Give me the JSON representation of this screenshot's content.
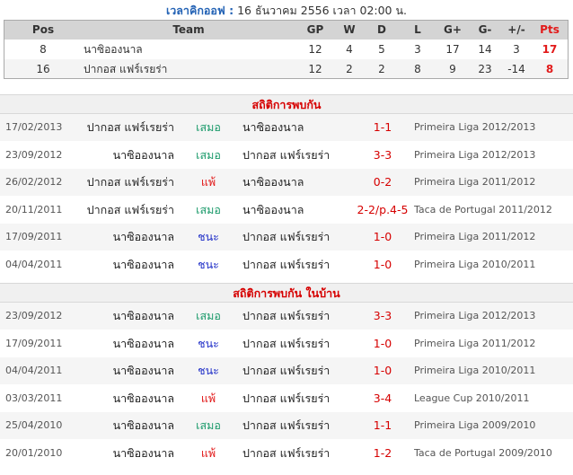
{
  "kickoff": {
    "label": "เวลาคิกออฟ :",
    "value": "16 ธันวาคม 2556 เวลา 02:00 น."
  },
  "standings": {
    "headers": [
      "Pos",
      "Team",
      "GP",
      "W",
      "D",
      "L",
      "G+",
      "G-",
      "+/-",
      "Pts"
    ],
    "rows": [
      {
        "pos": "8",
        "team": "นาซิอองนาล",
        "gp": "12",
        "w": "4",
        "d": "5",
        "l": "3",
        "gf": "17",
        "ga": "14",
        "diff": "3",
        "pts": "17"
      },
      {
        "pos": "16",
        "team": "ปากอส แฟร์เรยร่า",
        "gp": "12",
        "w": "2",
        "d": "2",
        "l": "8",
        "gf": "9",
        "ga": "23",
        "diff": "-14",
        "pts": "8"
      }
    ]
  },
  "h2h": {
    "title": "สถิติการพบกัน",
    "matches": [
      {
        "date": "17/02/2013",
        "home": "ปากอส แฟร์เรยร่า",
        "result": "เสมอ",
        "result_type": "draw",
        "away": "นาซิอองนาล",
        "score": "1-1",
        "competition": "Primeira Liga 2012/2013"
      },
      {
        "date": "23/09/2012",
        "home": "นาซิอองนาล",
        "result": "เสมอ",
        "result_type": "draw",
        "away": "ปากอส แฟร์เรยร่า",
        "score": "3-3",
        "competition": "Primeira Liga 2012/2013"
      },
      {
        "date": "26/02/2012",
        "home": "ปากอส แฟร์เรยร่า",
        "result": "แพ้",
        "result_type": "loss",
        "away": "นาซิอองนาล",
        "score": "0-2",
        "competition": "Primeira Liga 2011/2012"
      },
      {
        "date": "20/11/2011",
        "home": "ปากอส แฟร์เรยร่า",
        "result": "เสมอ",
        "result_type": "draw",
        "away": "นาซิอองนาล",
        "score": "2-2/p.4-5",
        "competition": "Taca de Portugal 2011/2012"
      },
      {
        "date": "17/09/2011",
        "home": "นาซิอองนาล",
        "result": "ชนะ",
        "result_type": "win",
        "away": "ปากอส แฟร์เรยร่า",
        "score": "1-0",
        "competition": "Primeira Liga 2011/2012"
      },
      {
        "date": "04/04/2011",
        "home": "นาซิอองนาล",
        "result": "ชนะ",
        "result_type": "win",
        "away": "ปากอส แฟร์เรยร่า",
        "score": "1-0",
        "competition": "Primeira Liga 2010/2011"
      }
    ]
  },
  "home_h2h": {
    "title": "สถิติการพบกัน ในบ้าน",
    "matches": [
      {
        "date": "23/09/2012",
        "home": "นาซิอองนาล",
        "result": "เสมอ",
        "result_type": "draw",
        "away": "ปากอส แฟร์เรยร่า",
        "score": "3-3",
        "competition": "Primeira Liga 2012/2013"
      },
      {
        "date": "17/09/2011",
        "home": "นาซิอองนาล",
        "result": "ชนะ",
        "result_type": "win",
        "away": "ปากอส แฟร์เรยร่า",
        "score": "1-0",
        "competition": "Primeira Liga 2011/2012"
      },
      {
        "date": "04/04/2011",
        "home": "นาซิอองนาล",
        "result": "ชนะ",
        "result_type": "win",
        "away": "ปากอส แฟร์เรยร่า",
        "score": "1-0",
        "competition": "Primeira Liga 2010/2011"
      },
      {
        "date": "03/03/2011",
        "home": "นาซิอองนาล",
        "result": "แพ้",
        "result_type": "loss",
        "away": "ปากอส แฟร์เรยร่า",
        "score": "3-4",
        "competition": "League Cup 2010/2011"
      },
      {
        "date": "25/04/2010",
        "home": "นาซิอองนาล",
        "result": "เสมอ",
        "result_type": "draw",
        "away": "ปากอส แฟร์เรยร่า",
        "score": "1-1",
        "competition": "Primeira Liga 2009/2010"
      },
      {
        "date": "20/01/2010",
        "home": "นาซิอองนาล",
        "result": "แพ้",
        "result_type": "loss",
        "away": "ปากอส แฟร์เรยร่า",
        "score": "1-2",
        "competition": "Taca de Portugal 2009/2010"
      }
    ]
  },
  "colors": {
    "draw": "#1a9a6a",
    "loss": "#e21a1a",
    "win": "#2231c8",
    "section_title": "#d60000",
    "kickoff_label": "#2463b5"
  }
}
